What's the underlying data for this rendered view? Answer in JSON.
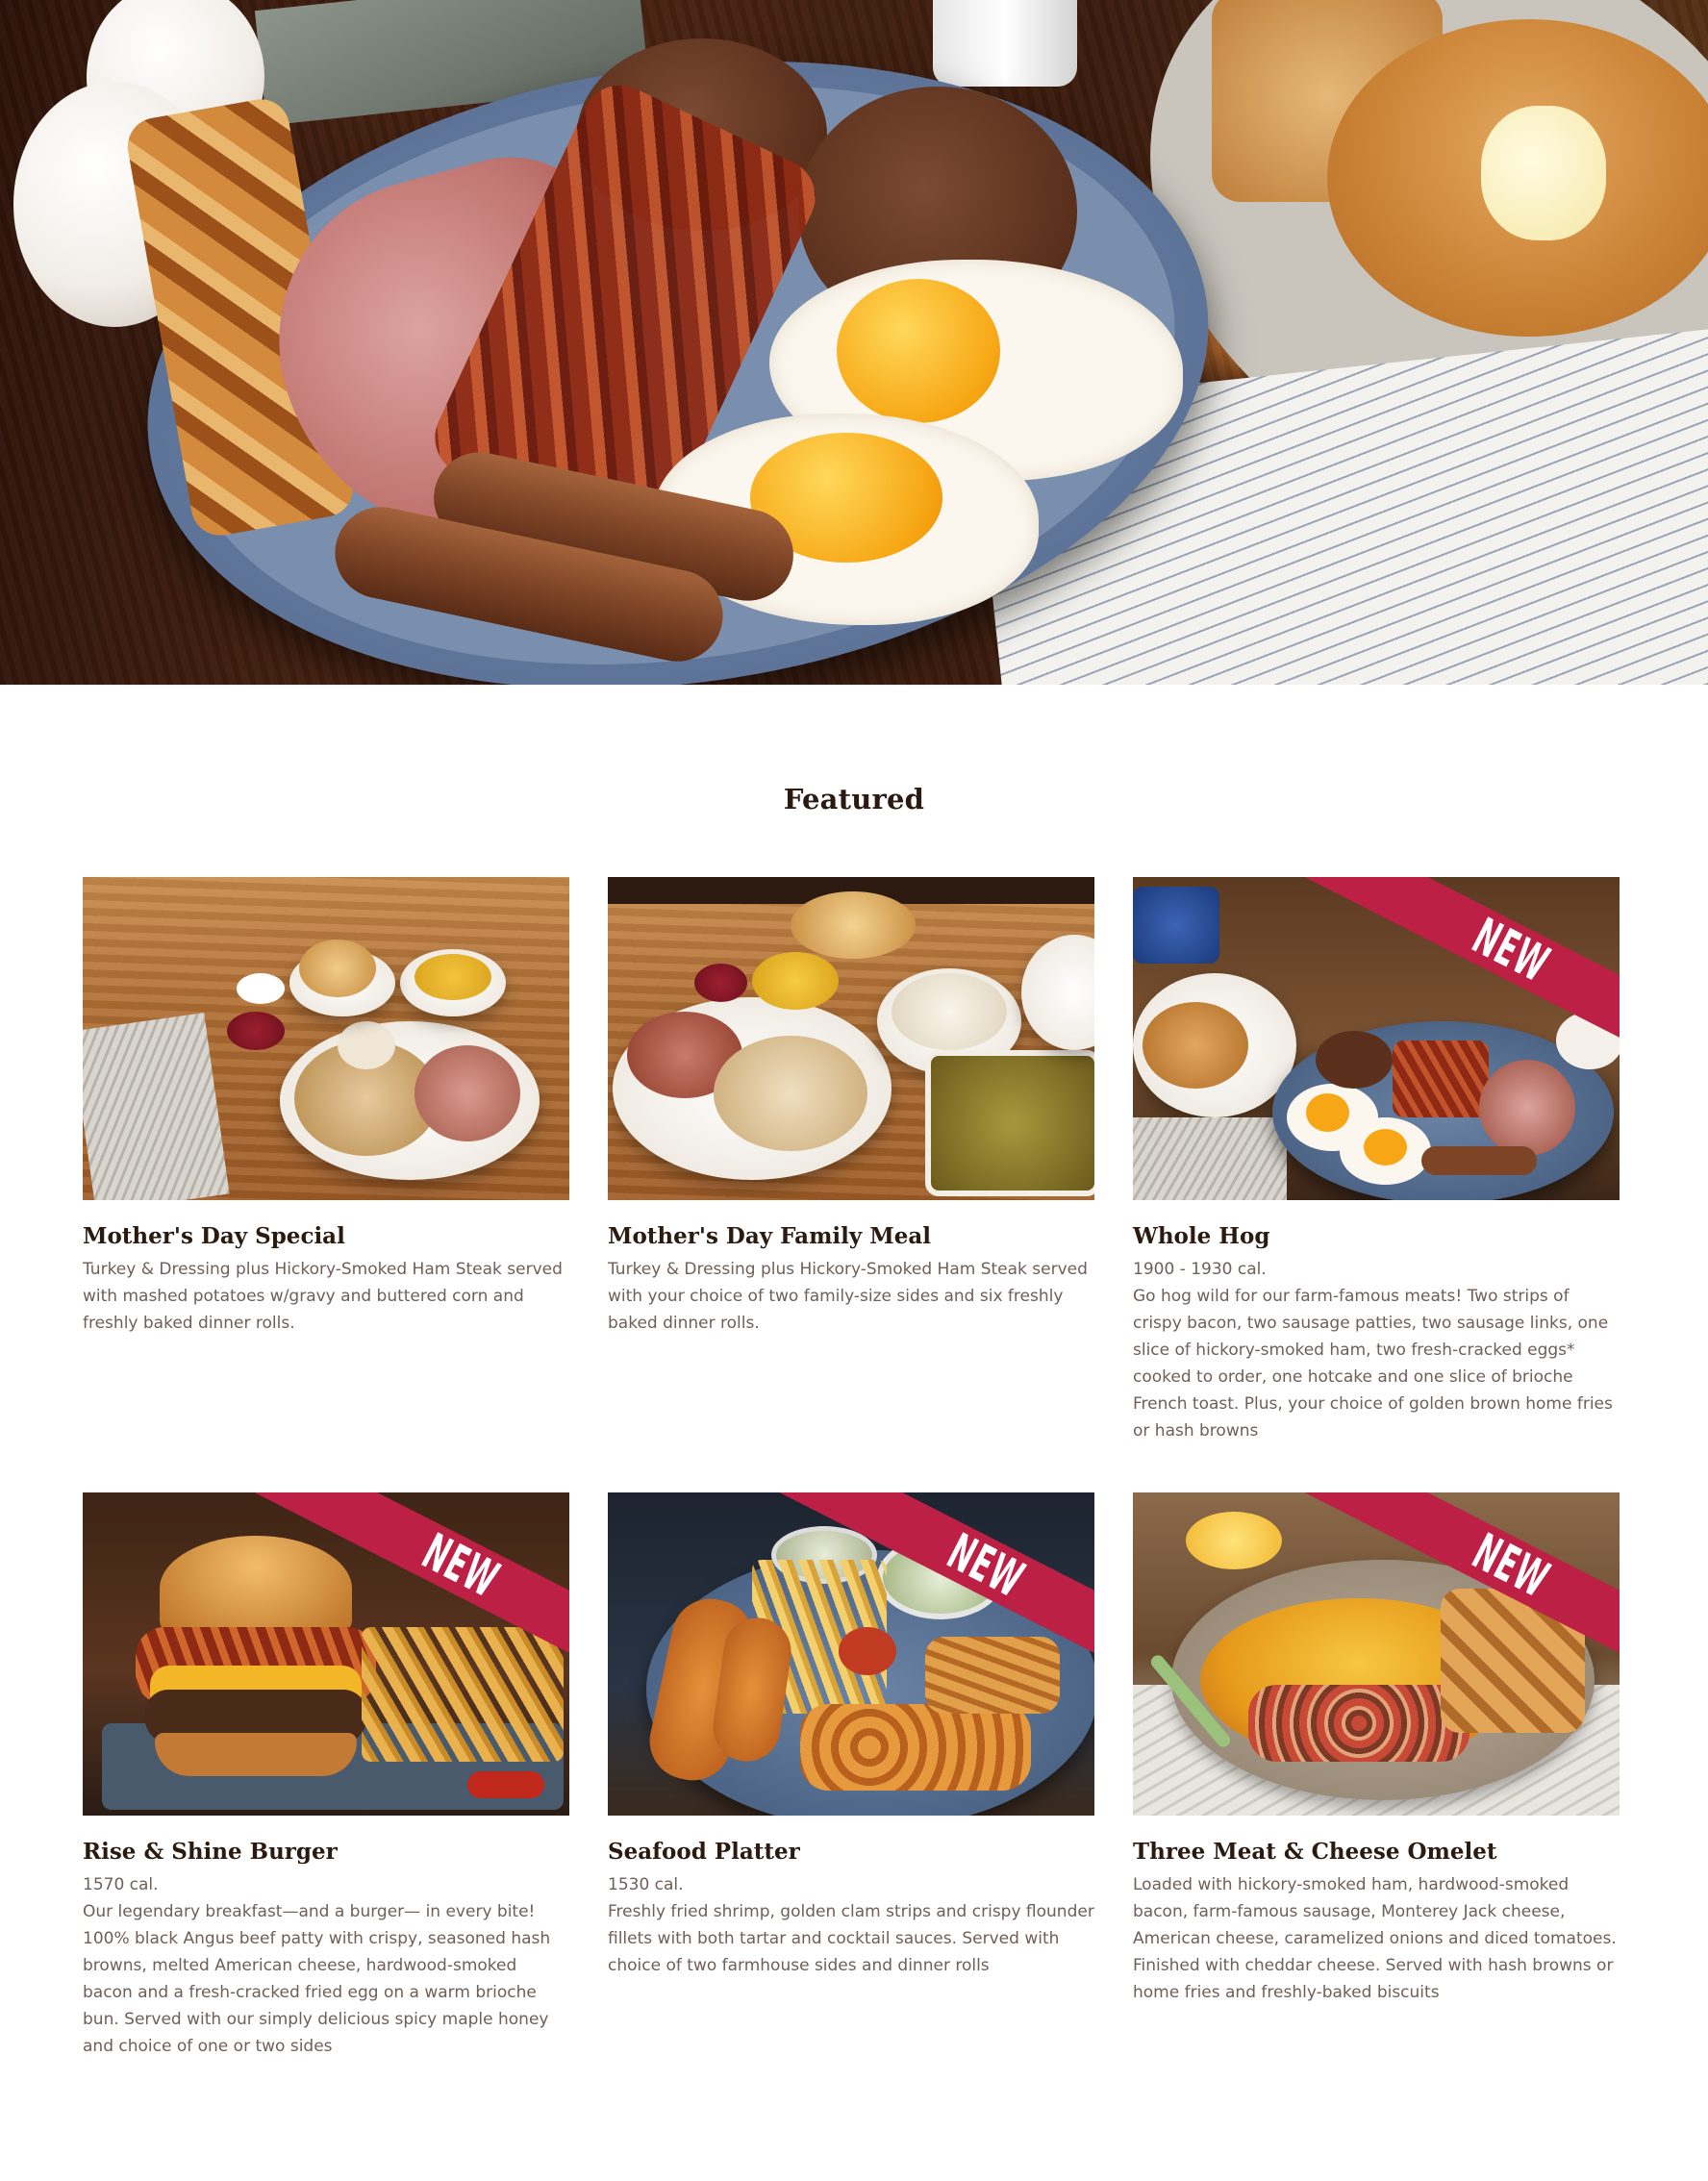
{
  "hero": {
    "image_alt": "Whole Hog breakfast platter with ham, bacon, sausage patties, sausage links, fried eggs, home fries, pancakes and French toast"
  },
  "featured": {
    "heading": "Featured",
    "badge_color": "#bc2044",
    "items": [
      {
        "title": "Mother's Day Special",
        "calories": null,
        "description": "Turkey & Dressing plus Hickory-Smoked Ham Steak served with mashed potatoes w/gravy and buttered corn and freshly baked dinner rolls.",
        "badge": null,
        "image_alt": "Turkey and dressing plate with ham steak, corn, cranberry sauce and dinner roll"
      },
      {
        "title": "Mother's Day Family Meal",
        "calories": null,
        "description": "Turkey & Dressing plus Hickory-Smoked Ham Steak served with your choice of two family-size sides and six freshly baked dinner rolls.",
        "badge": null,
        "image_alt": "Family meal platter of turkey, ham, dressing, mashed potatoes, corn and rolls"
      },
      {
        "title": "Whole Hog",
        "calories": "1900 - 1930 cal.",
        "description": "Go hog wild for our farm-famous meats! Two strips of crispy bacon, two sausage patties, two sausage links, one slice of hickory-smoked ham, two fresh-cracked eggs* cooked to order, one hotcake and one slice of brioche French toast. Plus, your choice of golden brown home fries or hash browns",
        "badge": "NEW",
        "image_alt": "Whole Hog breakfast plate with eggs, bacon, ham, sausage and pancakes"
      },
      {
        "title": "Rise & Shine Burger",
        "calories": "1570 cal.",
        "description": "Our legendary breakfast—and a burger— in every bite! 100% black Angus beef patty with crispy, seasoned hash browns, melted American cheese, hardwood-smoked bacon and a fresh-cracked fried egg on a warm brioche bun. Served with our simply delicious spicy maple honey and choice of one or two sides",
        "badge": "NEW",
        "image_alt": "Burger with fried egg, bacon and cheese served with fries"
      },
      {
        "title": "Seafood Platter",
        "calories": "1530 cal.",
        "description": "Freshly fried shrimp, golden clam strips and crispy flounder fillets with both tartar and cocktail sauces. Served with choice of two farmhouse sides and dinner rolls",
        "badge": "NEW",
        "image_alt": "Fried shrimp, clam strips and flounder with fries and coleslaw"
      },
      {
        "title": "Three Meat & Cheese Omelet",
        "calories": null,
        "description": "Loaded with hickory-smoked ham, hardwood-smoked bacon, farm-famous sausage, Monterey Jack cheese, American cheese, caramelized onions and diced tomatoes. Finished with cheddar cheese. Served with hash browns or home fries and freshly-baked biscuits",
        "badge": "NEW",
        "image_alt": "Omelet with cheese, ham and tomatoes served with home fries"
      }
    ]
  }
}
